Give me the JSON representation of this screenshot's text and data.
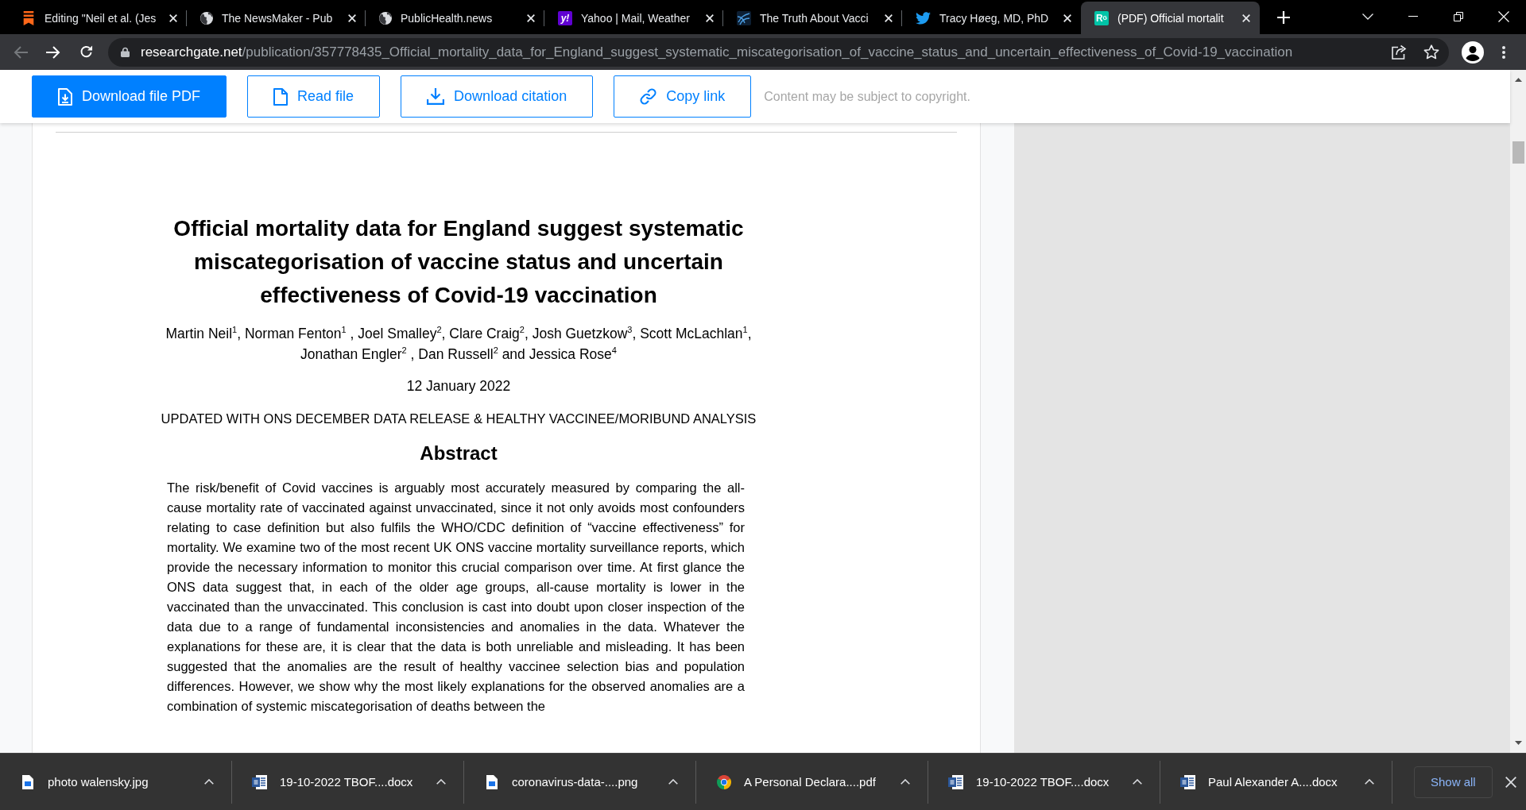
{
  "browser": {
    "tabs": [
      {
        "title": "Editing \"Neil et al. (Jes",
        "favicon": {
          "kind": "bookmark"
        },
        "selected": false
      },
      {
        "title": "The NewsMaker - Pub",
        "favicon": {
          "kind": "globe"
        },
        "selected": false
      },
      {
        "title": "PublicHealth.news",
        "favicon": {
          "kind": "globe"
        },
        "selected": false
      },
      {
        "title": "Yahoo | Mail, Weather",
        "favicon": {
          "kind": "letters",
          "text": "y!",
          "color": "#6001d2"
        },
        "selected": false
      },
      {
        "title": "The Truth About Vacci",
        "favicon": {
          "kind": "tile"
        },
        "selected": false
      },
      {
        "title": "Tracy Høeg, MD, PhD",
        "favicon": {
          "kind": "bird"
        },
        "selected": false
      },
      {
        "title": "(PDF) Official mortalit",
        "favicon": {
          "kind": "letters",
          "text": "R$^{G}$",
          "color": "#00c4a7"
        },
        "selected": true
      }
    ],
    "navigation": {
      "back_disabled": true,
      "forward_disabled": false
    },
    "address": {
      "host": "researchgate.net",
      "path": "/publication/357778435_Official_mortality_data_for_England_suggest_systematic_miscategorisation_of_vaccine_status_and_uncertain_effectiveness_of_Covid-19_vaccination"
    }
  },
  "page": {
    "actions": [
      {
        "label": "Download file PDF",
        "kind": "file-download",
        "primary": true
      },
      {
        "label": "Read file",
        "kind": "document",
        "primary": false
      },
      {
        "label": "Download citation",
        "kind": "download",
        "primary": false
      },
      {
        "label": "Copy link",
        "kind": "link",
        "primary": false
      }
    ],
    "notice": "Content may be subject to copyright.",
    "document": {
      "title": "Official mortality data for England suggest systematic miscategorisation of vaccine status and uncertain effectiveness of Covid-19 vaccination",
      "authors": "Martin Neil$^{1}$, Norman Fenton$^{1}$ , Joel Smalley$^{2}$, Clare Craig$^{2}$, Josh Guetzkow$^{3}$, Scott McLachlan$^{1}$, Jonathan Engler$^{2}$ , Dan Russell$^{2}$ and Jessica Rose$^{4}$",
      "date": "12 January 2022",
      "note": "UPDATED WITH ONS DECEMBER DATA RELEASE & HEALTHY VACCINEE/MORIBUND ANALYSIS",
      "abstract_heading": "Abstract",
      "abstract": "The risk/benefit of Covid vaccines is arguably most accurately measured by comparing the all-cause mortality rate of vaccinated against unvaccinated, since it not only avoids most confounders relating to case definition but also fulfils the WHO/CDC definition of “vaccine effectiveness” for mortality. We examine two of the most recent UK ONS vaccine mortality surveillance reports, which provide the necessary information to monitor this crucial comparison over time. At first glance the ONS data suggest that, in each of the older age groups, all-cause mortality is lower in the vaccinated than the unvaccinated. This conclusion is cast into doubt upon closer inspection of the data due to a range of fundamental inconsistencies and anomalies in the data. Whatever the explanations for these are, it is clear that the data is both unreliable and misleading. It has been suggested that the anomalies are the result of healthy vaccinee selection bias and population differences. However, we show why the most likely explanations for the observed anomalies are a combination of systemic miscategorisation of deaths between the"
    }
  },
  "downloads": {
    "items": [
      {
        "name": "photo walensky.jpg",
        "kind": "image"
      },
      {
        "name": "19-10-2022 TBOF....docx",
        "kind": "word"
      },
      {
        "name": "coronavirus-data-....png",
        "kind": "image"
      },
      {
        "name": "A Personal Declara....pdf",
        "kind": "web"
      },
      {
        "name": "19-10-2022 TBOF....docx",
        "kind": "word"
      },
      {
        "name": "Paul Alexander A....docx",
        "kind": "word"
      }
    ],
    "show_all": "Show all"
  }
}
